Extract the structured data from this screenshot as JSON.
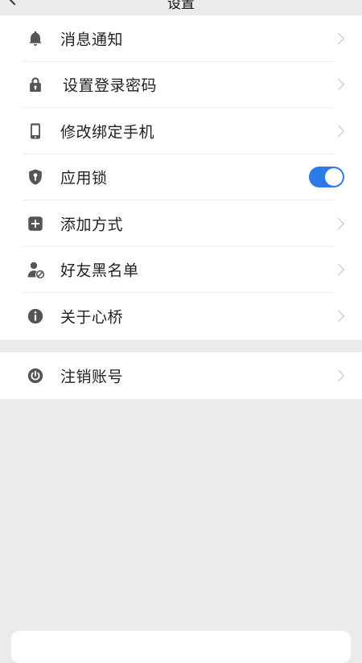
{
  "header": {
    "title": "设置"
  },
  "menu": [
    {
      "label": "消息通知",
      "icon": "bell-icon"
    },
    {
      "label": "设置登录密码",
      "icon": "lock-icon"
    },
    {
      "label": "修改绑定手机",
      "icon": "phone-icon"
    },
    {
      "label": "应用锁",
      "icon": "shield-key-icon",
      "toggle_on": true
    },
    {
      "label": "添加方式",
      "icon": "plus-square-icon"
    },
    {
      "label": "好友黑名单",
      "icon": "user-block-icon"
    },
    {
      "label": "关于心桥",
      "icon": "info-icon"
    }
  ],
  "logout": {
    "label": "注销账号",
    "icon": "power-icon"
  },
  "colors": {
    "accent": "#2c79e8",
    "icon": "#555555",
    "background": "#ebebeb"
  }
}
